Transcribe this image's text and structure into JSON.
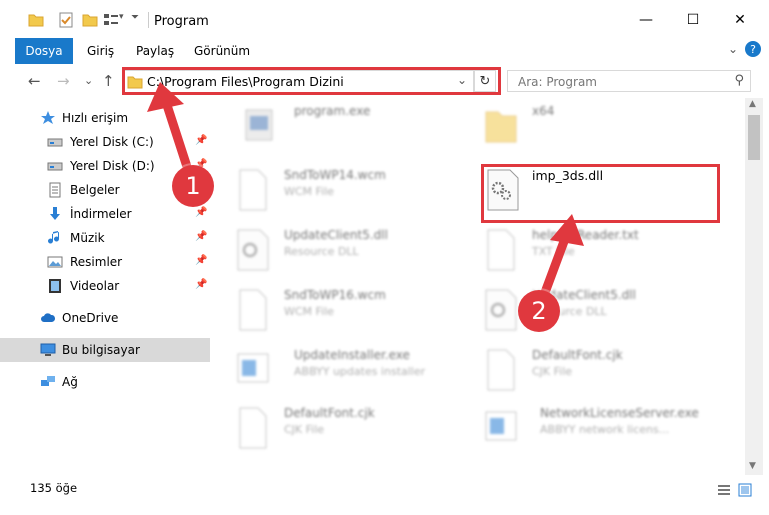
{
  "window": {
    "title": "Program",
    "minimize": "—",
    "maximize": "☐",
    "close": "✕"
  },
  "ribbon": {
    "tabs": [
      "Dosya",
      "Giriş",
      "Paylaş",
      "Görünüm"
    ],
    "collapse": "⌄",
    "help": "?"
  },
  "nav": {
    "back": "←",
    "forward": "→",
    "recent": "⌄",
    "up": "↑",
    "address": "C:\\Program Files\\Program Dizini",
    "dropdown": "⌄",
    "refresh": "↻",
    "search_placeholder": "Ara: Program"
  },
  "sidebar": {
    "items": [
      {
        "label": "Hızlı erişim",
        "icon": "star-icon"
      },
      {
        "label": "Yerel Disk (C:)",
        "icon": "drive-icon",
        "pinned": true
      },
      {
        "label": "Yerel Disk (D:)",
        "icon": "drive-icon",
        "pinned": true
      },
      {
        "label": "Belgeler",
        "icon": "documents-icon",
        "pinned": true
      },
      {
        "label": "İndirmeler",
        "icon": "download-icon",
        "pinned": true
      },
      {
        "label": "Müzik",
        "icon": "music-icon",
        "pinned": true
      },
      {
        "label": "Resimler",
        "icon": "pictures-icon",
        "pinned": true
      },
      {
        "label": "Videolar",
        "icon": "videos-icon",
        "pinned": true
      },
      {
        "label": "OneDrive",
        "icon": "cloud-icon"
      },
      {
        "label": "Bu bilgisayar",
        "icon": "computer-icon",
        "selected": true
      },
      {
        "label": "Ağ",
        "icon": "network-icon"
      }
    ]
  },
  "files": [
    {
      "name": "program.exe",
      "type": "",
      "icon": "exe-icon"
    },
    {
      "name": "x64",
      "type": "",
      "icon": "folder-icon"
    },
    {
      "name": "SndToWP14.wcm",
      "type": "WCM File",
      "icon": "file-icon"
    },
    {
      "name": "imp_3ds.dll",
      "type": "",
      "icon": "dll-icon"
    },
    {
      "name": "UpdateClient5.dll",
      "type": "Resource DLL",
      "icon": "dll-icon"
    },
    {
      "name": "helpmeReader.txt",
      "type": "TXT File",
      "icon": "file-icon"
    },
    {
      "name": "SndToWP16.wcm",
      "type": "WCM File",
      "icon": "file-icon"
    },
    {
      "name": "UpdateClient5.dll",
      "type": "Resource DLL",
      "icon": "dll-icon"
    },
    {
      "name": "UpdateInstaller.exe",
      "type": "ABBYY updates installer",
      "icon": "installer-icon"
    },
    {
      "name": "DefaultFont.cjk",
      "type": "CJK File",
      "icon": "file-icon"
    },
    {
      "name": "DefaultFont.cjk",
      "type": "CJK File",
      "icon": "file-icon"
    },
    {
      "name": "NetworkLicenseServer.exe",
      "type": "ABBYY network licens...",
      "icon": "installer-icon"
    }
  ],
  "status": {
    "item_count": "135 öğe"
  },
  "annotations": {
    "badge1": "1",
    "badge2": "2"
  },
  "colors": {
    "accent": "#1979ca",
    "annotation": "#e0383e",
    "selection": "#d9d9d9"
  }
}
